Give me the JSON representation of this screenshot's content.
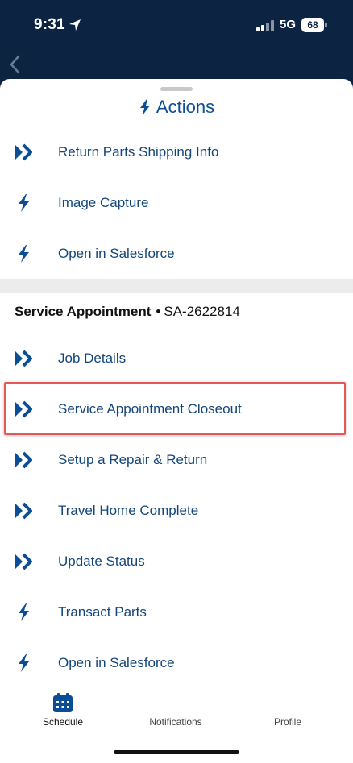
{
  "status_bar": {
    "time": "9:31",
    "network": "5G",
    "battery": "68"
  },
  "sheet": {
    "title": "Actions"
  },
  "top_actions": [
    {
      "label": "Return Parts Shipping Info",
      "icon": "chevrons-right-icon"
    },
    {
      "label": "Image Capture",
      "icon": "bolt-icon"
    },
    {
      "label": "Open in Salesforce",
      "icon": "bolt-icon"
    }
  ],
  "section": {
    "name": "Service Appointment",
    "separator": "•",
    "id": "SA-2622814"
  },
  "section_actions": [
    {
      "label": "Job Details",
      "icon": "chevrons-right-icon"
    },
    {
      "label": "Service Appointment Closeout",
      "icon": "chevrons-right-icon",
      "highlighted": true
    },
    {
      "label": "Setup a Repair & Return",
      "icon": "chevrons-right-icon"
    },
    {
      "label": "Travel Home Complete",
      "icon": "chevrons-right-icon"
    },
    {
      "label": "Update Status",
      "icon": "chevrons-right-icon"
    },
    {
      "label": "Transact Parts",
      "icon": "bolt-icon"
    },
    {
      "label": "Open in Salesforce",
      "icon": "bolt-icon"
    }
  ],
  "bottom_nav": [
    {
      "label": "Schedule",
      "icon": "calendar-icon",
      "active": true
    },
    {
      "label": "Notifications",
      "icon": "",
      "active": false
    },
    {
      "label": "Profile",
      "icon": "",
      "active": false
    }
  ],
  "colors": {
    "header_bg": "#0c2342",
    "accent": "#0b4e96",
    "highlight_border": "#e05a5a"
  }
}
